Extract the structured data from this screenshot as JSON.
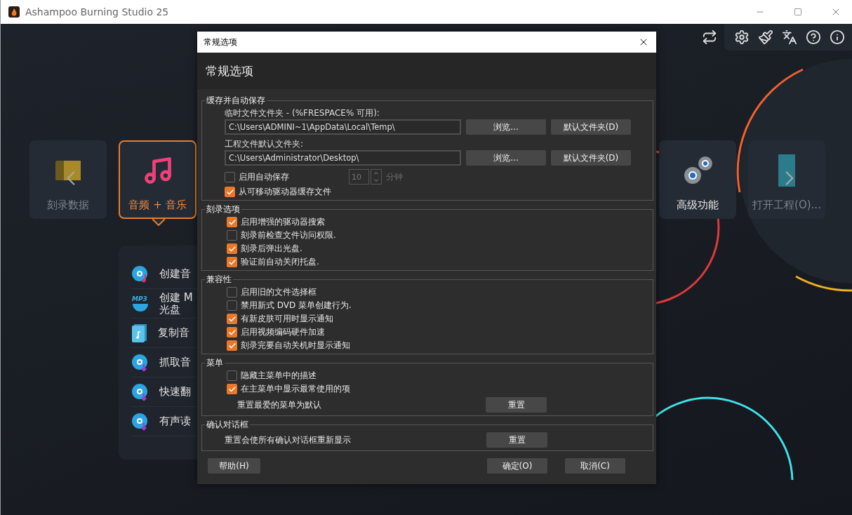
{
  "window": {
    "title": "Ashampoo Burning Studio 25"
  },
  "tiles": [
    {
      "label": "刻录数据",
      "kind": "folder",
      "selected": false,
      "disabled": true
    },
    {
      "label": "音频 + 音乐",
      "kind": "music",
      "selected": true,
      "disabled": false
    },
    {
      "label": "高级功能",
      "kind": "gears",
      "selected": false,
      "disabled": false
    },
    {
      "label": "打开工程(O)...",
      "kind": "file",
      "selected": false,
      "disabled": true
    }
  ],
  "list_items": [
    {
      "lines": [
        "创建音"
      ],
      "kind": "disc-note"
    },
    {
      "lines": [
        "创建 M",
        "光盘"
      ],
      "kind": "mp3",
      "badge": "MP3"
    },
    {
      "lines": [
        "复制音"
      ],
      "kind": "file"
    },
    {
      "lines": [
        "抓取音"
      ],
      "kind": "disc-down"
    },
    {
      "lines": [
        "快速翻"
      ],
      "kind": "disc-down"
    },
    {
      "lines": [
        "有声读"
      ],
      "kind": "disc-down"
    }
  ],
  "dialog": {
    "title": "常规选项",
    "heading": "常规选项",
    "groups": [
      {
        "title": "缓存并自动保存",
        "items": [
          {
            "kind": "folder",
            "label": "临时文件文件夹 - (%FRESPACE% 可用):",
            "value": "C:\\Users\\ADMINI~1\\AppData\\Local\\Temp\\",
            "buttons": [
              "浏览...",
              "默认文件夹(D)"
            ]
          },
          {
            "kind": "folder",
            "label": "工程文件默认文件夹:",
            "value": "C:\\Users\\Administrator\\Desktop\\",
            "buttons": [
              "浏览...",
              "默认文件夹(D)"
            ]
          },
          {
            "kind": "checkbox-spin",
            "label": "启用自动保存",
            "checked": false,
            "spin_value": "10",
            "spin_unit": "分钟",
            "disabled": true
          },
          {
            "kind": "checkbox",
            "label": "从可移动驱动器缓存文件",
            "checked": true
          }
        ]
      },
      {
        "title": "刻录选项",
        "items": [
          {
            "kind": "checkbox",
            "label": "启用增强的驱动器搜索",
            "checked": true
          },
          {
            "kind": "checkbox",
            "label": "刻录前检查文件访问权限.",
            "checked": false
          },
          {
            "kind": "checkbox",
            "label": "刻录后弹出光盘.",
            "checked": true
          },
          {
            "kind": "checkbox",
            "label": "验证前自动关闭托盘.",
            "checked": true
          }
        ]
      },
      {
        "title": "兼容性",
        "items": [
          {
            "kind": "checkbox",
            "label": "启用旧的文件选择框",
            "checked": false
          },
          {
            "kind": "checkbox",
            "label": "禁用新式 DVD 菜单创建行为.",
            "checked": false
          },
          {
            "kind": "checkbox",
            "label": "有新皮肤可用时显示通知",
            "checked": true
          },
          {
            "kind": "checkbox",
            "label": "启用视频编码硬件加速",
            "checked": true
          },
          {
            "kind": "checkbox",
            "label": "刻录完要自动关机时显示通知",
            "checked": true
          }
        ]
      },
      {
        "title": "菜单",
        "items": [
          {
            "kind": "checkbox",
            "label": "隐藏主菜单中的描述",
            "checked": false
          },
          {
            "kind": "checkbox",
            "label": "在主菜单中显示最常使用的项",
            "checked": true
          },
          {
            "kind": "reset",
            "label": "重置最爱的菜单为默认",
            "button": "重置",
            "indent": true
          }
        ]
      },
      {
        "title": "确认对话框",
        "items": [
          {
            "kind": "reset",
            "label": "重置会使所有确认对话框重新显示",
            "button": "重置",
            "indent": false
          }
        ]
      }
    ],
    "footer": {
      "help": "帮助(H)",
      "ok": "确定(O)",
      "cancel": "取消(C)"
    }
  }
}
